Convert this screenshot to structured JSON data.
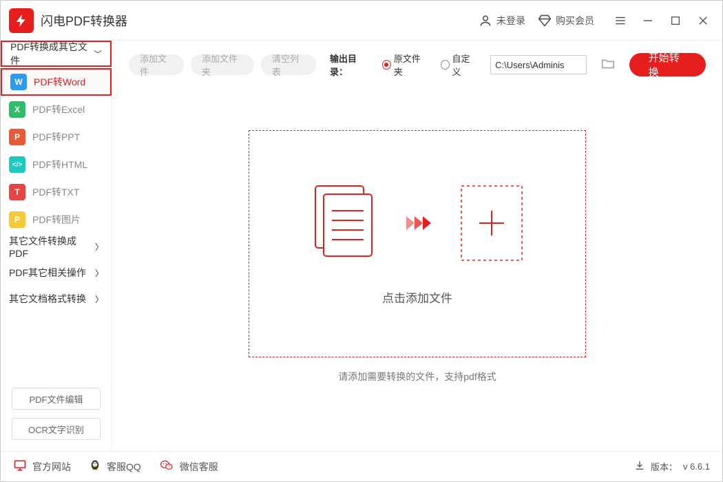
{
  "titlebar": {
    "app_name": "闪电PDF转换器",
    "login_label": "未登录",
    "buy_vip_label": "购买会员"
  },
  "sidebar": {
    "cat1_label": "PDF转换成其它文件",
    "cat2_label": "其它文件转换成PDF",
    "cat3_label": "PDF其它相关操作",
    "cat4_label": "其它文档格式转换",
    "items": [
      {
        "icon": "W",
        "color": "#2e9bf0",
        "label": "PDF转Word"
      },
      {
        "icon": "X",
        "color": "#2ebd6a",
        "label": "PDF转Excel"
      },
      {
        "icon": "P",
        "color": "#e65a35",
        "label": "PDF转PPT"
      },
      {
        "icon": "</>",
        "color": "#1ec9c0",
        "label": "PDF转HTML"
      },
      {
        "icon": "T",
        "color": "#e64545",
        "label": "PDF转TXT"
      },
      {
        "icon": "P",
        "color": "#f5c93a",
        "label": "PDF转图片"
      }
    ],
    "btn_edit": "PDF文件编辑",
    "btn_ocr": "OCR文字识别"
  },
  "toolbar": {
    "add_file": "添加文件",
    "add_folder": "添加文件夹",
    "clear_list": "清空列表",
    "output_label": "输出目录：",
    "radio_source": "原文件夹",
    "radio_custom": "自定义",
    "path_value": "C:\\Users\\Adminis",
    "start_label": "开始转换"
  },
  "dropzone": {
    "click_label": "点击添加文件",
    "hint": "请添加需要转换的文件，支持pdf格式"
  },
  "statusbar": {
    "website": "官方网站",
    "qq": "客服QQ",
    "wechat": "微信客服",
    "version_prefix": "版本：",
    "version": "v 6.6.1"
  }
}
